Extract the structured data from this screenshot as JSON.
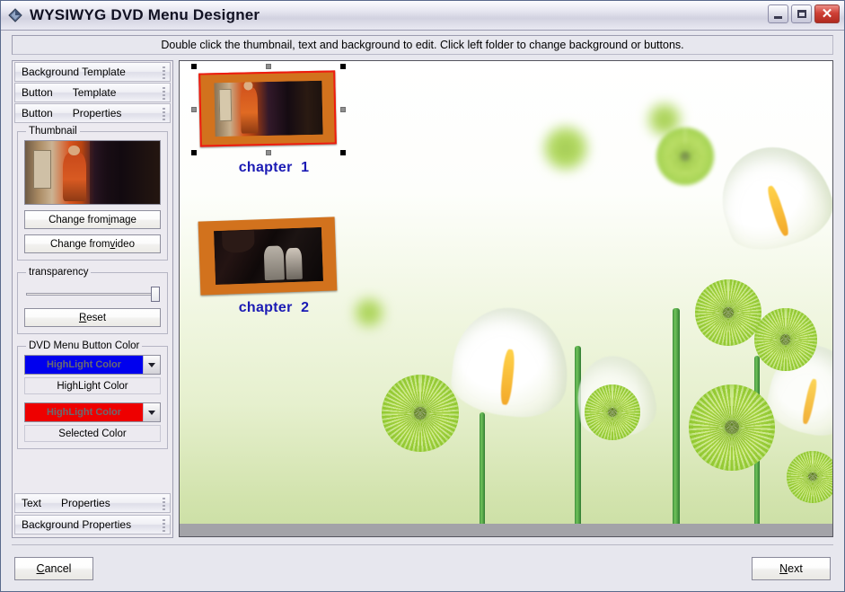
{
  "window": {
    "title": "WYSIWYG DVD Menu Designer",
    "icon": "dvd-diamond-icon",
    "controls": {
      "minimize": "minimize-icon",
      "maximize": "maximize-icon",
      "close": "✕"
    }
  },
  "instruction": {
    "text": "Double click the thumbnail, text and background to edit. Click left folder to change background or buttons."
  },
  "sidebar": {
    "sections_top": [
      {
        "label": "Background Template",
        "label2": ""
      },
      {
        "label": "Button",
        "label2": "Template"
      },
      {
        "label": "Button",
        "label2": "Properties"
      }
    ],
    "sections_bottom": [
      {
        "label": "Text",
        "label2": "Properties"
      },
      {
        "label": "Background Properties",
        "label2": ""
      }
    ],
    "thumbnail": {
      "legend": "Thumbnail",
      "change_from_image": "Change from image",
      "change_from_image_pre": "Change from ",
      "change_from_image_key": "i",
      "change_from_image_post": "mage",
      "change_from_video_pre": "Change from ",
      "change_from_video_key": "v",
      "change_from_video_post": "ideo"
    },
    "transparency": {
      "legend": "transparency",
      "reset_pre": "",
      "reset_key": "R",
      "reset_post": "eset",
      "value": 100
    },
    "button_color": {
      "legend": "DVD Menu Button Color",
      "highlight": {
        "swatch_text": "HighLight Color",
        "color": "#0000ee",
        "label": "HighLight Color"
      },
      "selected": {
        "swatch_text": "HighLight Color",
        "color": "#ee0000",
        "label": "Selected Color"
      }
    }
  },
  "canvas": {
    "background_name": "white-calla-lily-green-pompom-background",
    "chapters": [
      {
        "label": "chapter  1",
        "selected": true,
        "frame_color": "#d2721d",
        "highlight_color": "#ee1b10"
      },
      {
        "label": "chapter  2",
        "selected": false,
        "frame_color": "#d2721d",
        "highlight_color": "#ee1b10"
      }
    ],
    "label_color": "#1a1ab4"
  },
  "footer": {
    "cancel_pre": "",
    "cancel_key": "C",
    "cancel_post": "ancel",
    "next_pre": "",
    "next_key": "N",
    "next_post": "ext"
  }
}
